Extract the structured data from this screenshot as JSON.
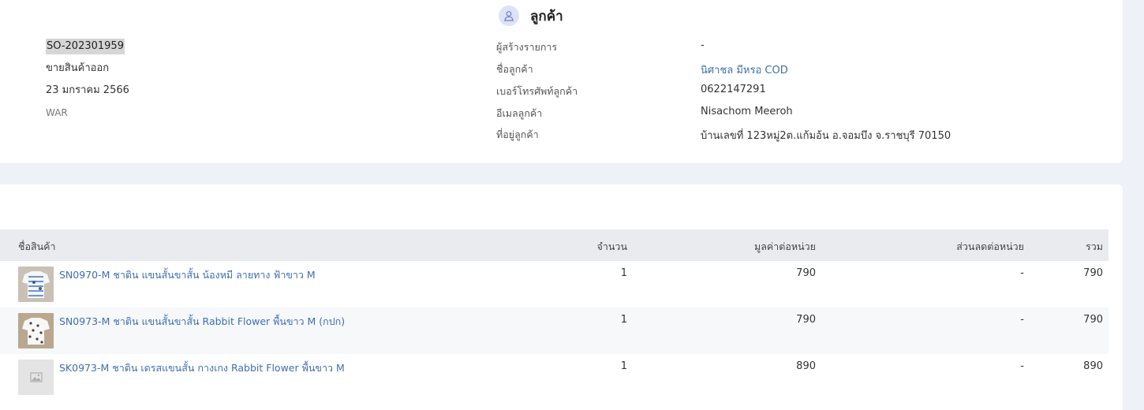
{
  "customer_section": {
    "title": "ลูกค้า"
  },
  "order": {
    "number": "SO-202301959",
    "type": "ขายสินค้าออก",
    "date": "23 มกราคม 2566",
    "warehouse": "WAR"
  },
  "details": {
    "creator_label": "ผู้สร้างรายการ",
    "creator_value": "-",
    "customer_name_label": "ชื่อลูกค้า",
    "customer_name_value": "นิศาชล มีหรอ COD",
    "phone_label": "เบอร์โทรศัพท์ลูกค้า",
    "phone_value": "0622147291",
    "email_label": "อีเมลลูกค้า",
    "email_value": "Nisachom Meeroh",
    "address_label": "ที่อยู่ลูกค้า",
    "address_value": "บ้านเลขที่ 123หมู่2ต.แก้มอ้น อ.จอมบึง จ.ราชบุรี 70150"
  },
  "table": {
    "headers": {
      "product": "ชื่อสินค้า",
      "qty": "จำนวน",
      "unit_price": "มูลค่าต่อหน่วย",
      "discount": "ส่วนลดต่อหน่วย",
      "total": "รวม"
    },
    "rows": [
      {
        "name": "SN0970-M ชาติน แขนสั้นขาสั้น น้องหมี ลายทาง ฟ้าขาว M",
        "qty": "1",
        "unit_price": "790",
        "discount": "-",
        "total": "790",
        "image": "pajama-blue-icon"
      },
      {
        "name": "SN0973-M ชาติน แขนสั้นขาสั้น Rabbit Flower พื้นขาว M (กปก)",
        "qty": "1",
        "unit_price": "790",
        "discount": "-",
        "total": "790",
        "image": "pajama-rabbit-icon"
      },
      {
        "name": "SK0973-M ชาติน เดรสแขนสั้น กางเกง Rabbit Flower พื้นขาว M",
        "qty": "1",
        "unit_price": "890",
        "discount": "-",
        "total": "890",
        "image": "image-placeholder-icon"
      }
    ]
  },
  "colors": {
    "accent": "#3f6fb0",
    "background": "#eef1f8",
    "header_bg": "#e9ebee"
  }
}
